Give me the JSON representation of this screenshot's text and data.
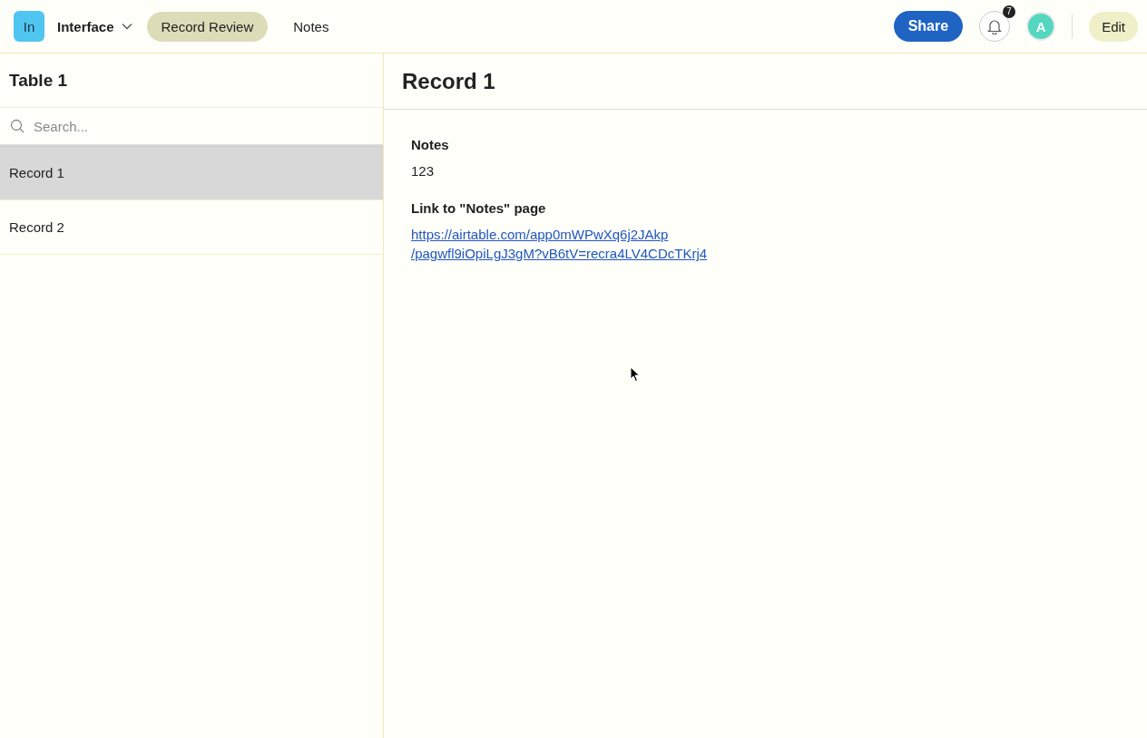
{
  "topbar": {
    "app_badge": "In",
    "app_name": "Interface",
    "tabs": [
      {
        "label": "Record Review",
        "selected": true
      },
      {
        "label": "Notes",
        "selected": false
      }
    ],
    "share": "Share",
    "notification_count": "7",
    "avatar": "A",
    "edit": "Edit"
  },
  "sidebar": {
    "title": "Table 1",
    "search": {
      "placeholder": "Search..."
    },
    "records": [
      {
        "label": "Record 1",
        "selected": true
      },
      {
        "label": "Record 2",
        "selected": false
      }
    ]
  },
  "detail": {
    "title": "Record 1",
    "fields": [
      {
        "kind": "text",
        "label": "Notes",
        "value": "123"
      },
      {
        "kind": "link",
        "label": "Link to \"Notes\" page",
        "lines": [
          "https://airtable.com/app0mWPwXq6j2JAkp",
          "/pagwfl9iOpiLgJ3gM?vB6tV=recra4LV4CDcTKrj4"
        ]
      }
    ]
  }
}
